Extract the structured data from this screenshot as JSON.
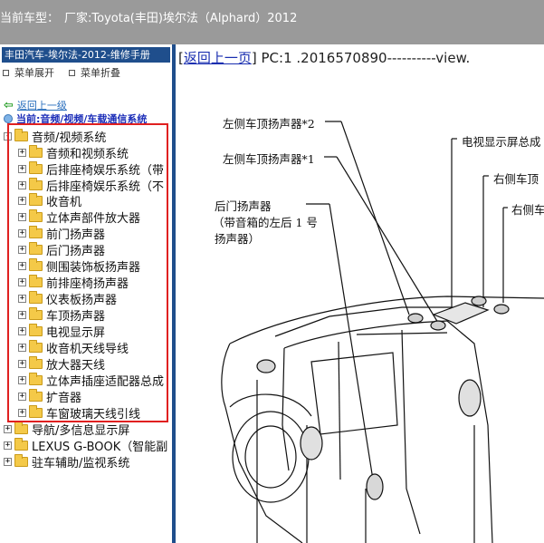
{
  "window": {
    "title_label": "当前车型：",
    "title_value": "厂家:Toyota(丰田)埃尔法（Alphard）2012"
  },
  "sidebar": {
    "manual_title": "丰田汽车-埃尔法-2012-维修手册",
    "expand_all": "菜单展开",
    "collapse_all": "菜单折叠",
    "back_link": "返回上一级",
    "current_path": "当前:音频/视频/车载通信系统",
    "tree": [
      {
        "label": "音频/视频系统",
        "sign": "-"
      },
      {
        "label": "音频和视频系统",
        "sign": "+"
      },
      {
        "label": "后排座椅娱乐系统（带",
        "sign": "+"
      },
      {
        "label": "后排座椅娱乐系统（不",
        "sign": "+"
      },
      {
        "label": "收音机",
        "sign": "+"
      },
      {
        "label": "立体声部件放大器",
        "sign": "+"
      },
      {
        "label": "前门扬声器",
        "sign": "+"
      },
      {
        "label": "后门扬声器",
        "sign": "+"
      },
      {
        "label": "侧围装饰板扬声器",
        "sign": "+"
      },
      {
        "label": "前排座椅扬声器",
        "sign": "+"
      },
      {
        "label": "仪表板扬声器",
        "sign": "+"
      },
      {
        "label": "车顶扬声器",
        "sign": "+"
      },
      {
        "label": "电视显示屏",
        "sign": "+"
      },
      {
        "label": "收音机天线导线",
        "sign": "+"
      },
      {
        "label": "放大器天线",
        "sign": "+"
      },
      {
        "label": "立体声插座适配器总成",
        "sign": "+"
      },
      {
        "label": "扩音器",
        "sign": "+"
      },
      {
        "label": "车窗玻璃天线引线",
        "sign": "+"
      },
      {
        "label": "导航/多信息显示屏",
        "sign": "+"
      },
      {
        "label": "LEXUS G-BOOK（智能副",
        "sign": "+"
      },
      {
        "label": "驻车辅助/监视系统",
        "sign": "+"
      }
    ]
  },
  "content": {
    "back_link": "返回上一页",
    "page_code": "PC:1 .2016570890----------view.",
    "labels": {
      "roof_left_2": "左侧车顶扬声器*2",
      "roof_left_1": "左侧车顶扬声器*1",
      "tv_display": "电视显示屏总成",
      "roof_right_a": "右侧车顶",
      "roof_right_b": "右侧车",
      "rear_door_title": "后门扬声器",
      "rear_door_sub1": "（带音箱的左后 1 号",
      "rear_door_sub2": "扬声器）"
    }
  },
  "colors": {
    "topbar": "#9a9a9a",
    "sidebar_title": "#1f4e8c",
    "highlight_box": "#e02020",
    "link": "#1a2fb0"
  }
}
